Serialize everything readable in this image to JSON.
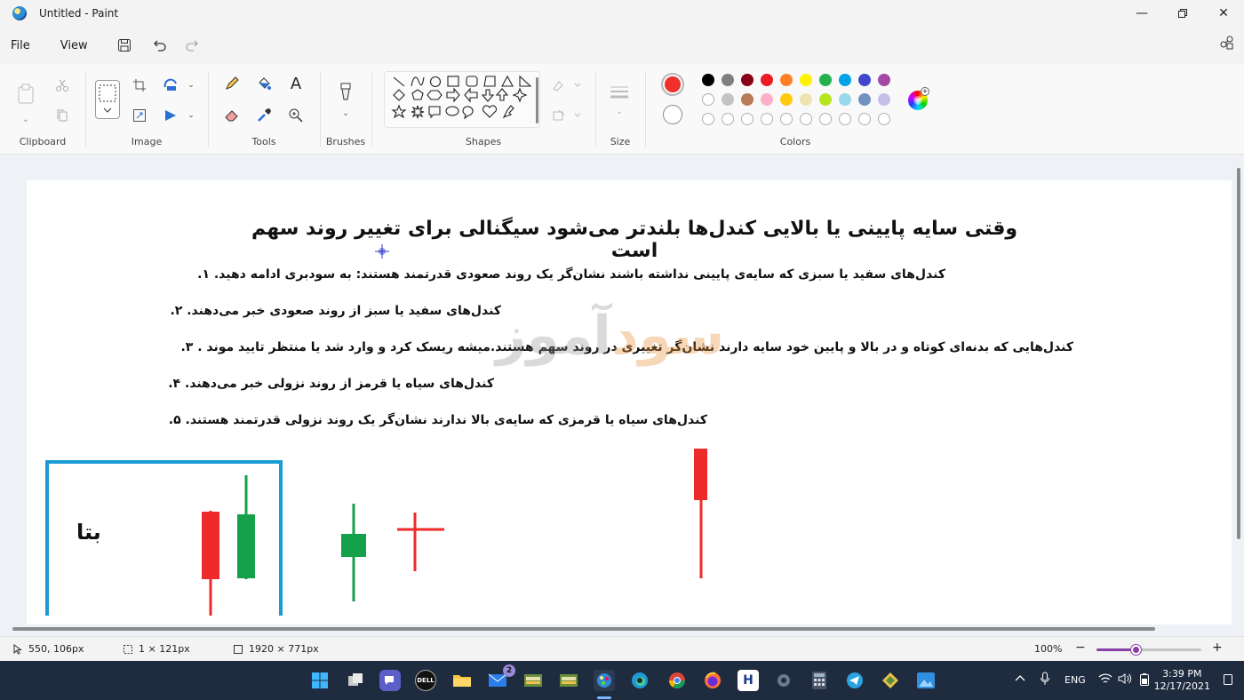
{
  "window": {
    "title": "Untitled - Paint"
  },
  "menu": {
    "file": "File",
    "view": "View"
  },
  "ribbon": {
    "groups": [
      "Clipboard",
      "Image",
      "Tools",
      "Brushes",
      "Shapes",
      "Size",
      "Colors"
    ],
    "primary_color": "#f0302a",
    "palette_row1": [
      "#000000",
      "#7f7f7f",
      "#880015",
      "#ed1c24",
      "#ff7f27",
      "#fff200",
      "#22b14c",
      "#00a2e8",
      "#3f48cc",
      "#a349a4"
    ],
    "palette_row2": [
      "#ffffff",
      "#c3c3c3",
      "#b97a57",
      "#ffaec9",
      "#ffc90e",
      "#efe4b0",
      "#b5e61d",
      "#99d9ea",
      "#7092be",
      "#c8bfe7"
    ]
  },
  "canvas": {
    "headline": "وقتی سایه پایینی یا بالایی کندل‌ها بلندتر می‌شود  سیگنالی برای تغییر روند سهم است",
    "lines": [
      {
        "num": "۱.",
        "text": "کندل‌های سفید یا سبزی که سایه‌ی پایینی نداشته باشند نشان‌گر یک روند صعودی قدرتمند هستند: به سودبری ادامه دهید."
      },
      {
        "num": "۲.",
        "text": "کندل‌های سفید یا سبز از روند صعودی خبر می‌دهند."
      },
      {
        "num": "۳.",
        "text": "کندل‌هایی که بدنه‌ای کوتاه و در بالا و پایین خود سایه دارند نشان‌گر تغییری در روند سهم هستند.میشه ریسک کرد و وارد شد یا منتظر تایید موند ."
      },
      {
        "num": "۴.",
        "text": "کندل‌های سیاه یا قرمز از روند نزولی خبر می‌دهند."
      },
      {
        "num": "۵.",
        "text": "کندل‌های سیاه یا قرمزی که سایه‌ی بالا ندارند نشان‌گر یک روند نزولی قدرتمند هستند."
      }
    ],
    "watermark_a": "سود",
    "watermark_b": "آموز",
    "beta_label": "بتا"
  },
  "status": {
    "cursor_pos": "550, 106px",
    "selection_size": "1 × 121px",
    "canvas_size": "1920 × 771px",
    "zoom": "100%",
    "zoom_level": 0.38
  },
  "taskbar": {
    "mail_badge": "2",
    "lang": "ENG",
    "time": "3:39 PM",
    "date": "12/17/2021"
  }
}
